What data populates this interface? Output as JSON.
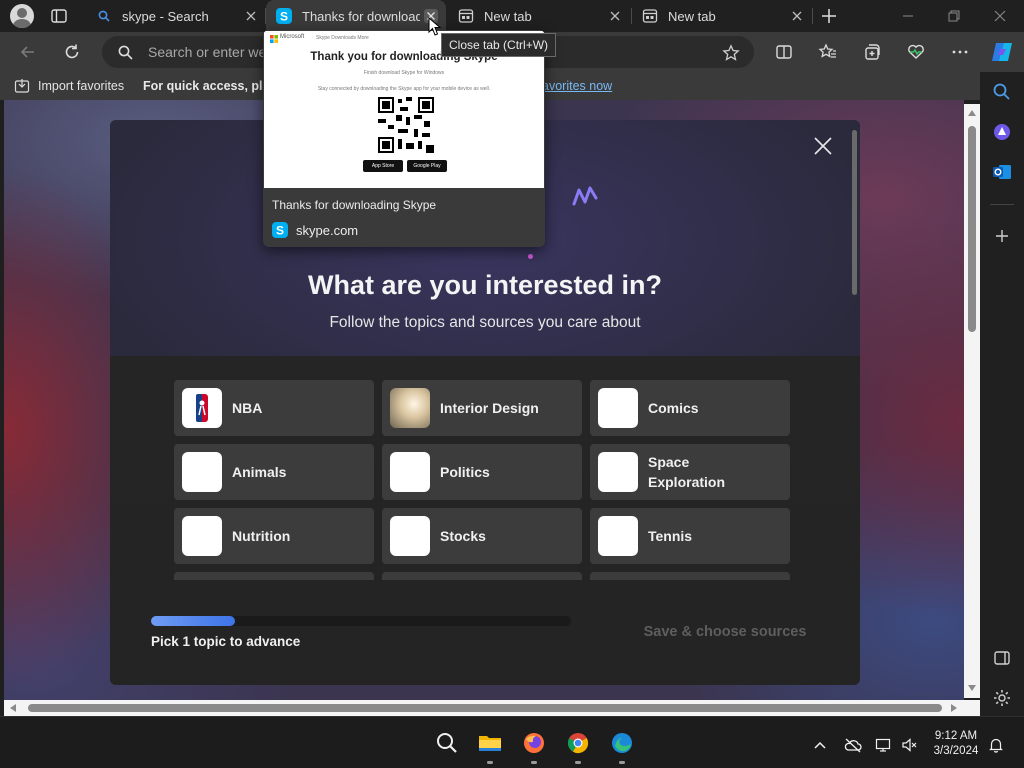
{
  "browser": {
    "tabs": [
      {
        "title": "skype - Search",
        "icon": "search-icon"
      },
      {
        "title": "Thanks for downloadi",
        "icon": "skype-icon"
      },
      {
        "title": "New tab",
        "icon": "newtab-page-icon"
      },
      {
        "title": "New tab",
        "icon": "newtab-page-icon"
      }
    ],
    "tooltip": "Close tab (Ctrl+W)",
    "address_placeholder": "Search or enter we",
    "favorites_bar": {
      "import_label": "Import favorites",
      "quick_access_text": "For quick access, place",
      "manage_link": "avorites now"
    }
  },
  "tab_preview": {
    "page_heading": "Thank you for downloading Skype",
    "page_header_brand": "Microsoft",
    "page_header_crumbs": "Skype   Downloads   More",
    "page_line1": "Finish download Skype for Windows",
    "page_line2": "Stay connected by downloading the Skype app for your mobile device as well.",
    "app_store": "App Store",
    "google_play": "Google Play",
    "title": "Thanks for downloading Skype",
    "domain": "skype.com"
  },
  "modal": {
    "heading": "What are you interested in?",
    "subheading": "Follow the topics and sources you care about",
    "topics": [
      {
        "label": "NBA",
        "icon": "nba-logo"
      },
      {
        "label": "Interior Design",
        "icon": "interior-design-image"
      },
      {
        "label": "Comics",
        "icon": "comics-image"
      },
      {
        "label": "Animals",
        "icon": "animals-image"
      },
      {
        "label": "Politics",
        "icon": "politics-image"
      },
      {
        "label": "Space Exploration",
        "icon": "space-image"
      },
      {
        "label": "Nutrition",
        "icon": "nutrition-image"
      },
      {
        "label": "Stocks",
        "icon": "stocks-image"
      },
      {
        "label": "Tennis",
        "icon": "tennis-image"
      }
    ],
    "progress_percent": 20,
    "progress_label": "Pick 1 topic to advance",
    "save_button": "Save & choose sources"
  },
  "taskbar": {
    "apps": [
      "search-icon",
      "file-explorer-icon",
      "firefox-icon",
      "chrome-icon",
      "edge-icon"
    ],
    "time": "9:12 AM",
    "date": "3/3/2024"
  },
  "colors": {
    "accent": "#3d74e8",
    "link": "#79b8f3",
    "chrome_bg": "#202020",
    "toolbar_bg": "#3a3a3a"
  }
}
